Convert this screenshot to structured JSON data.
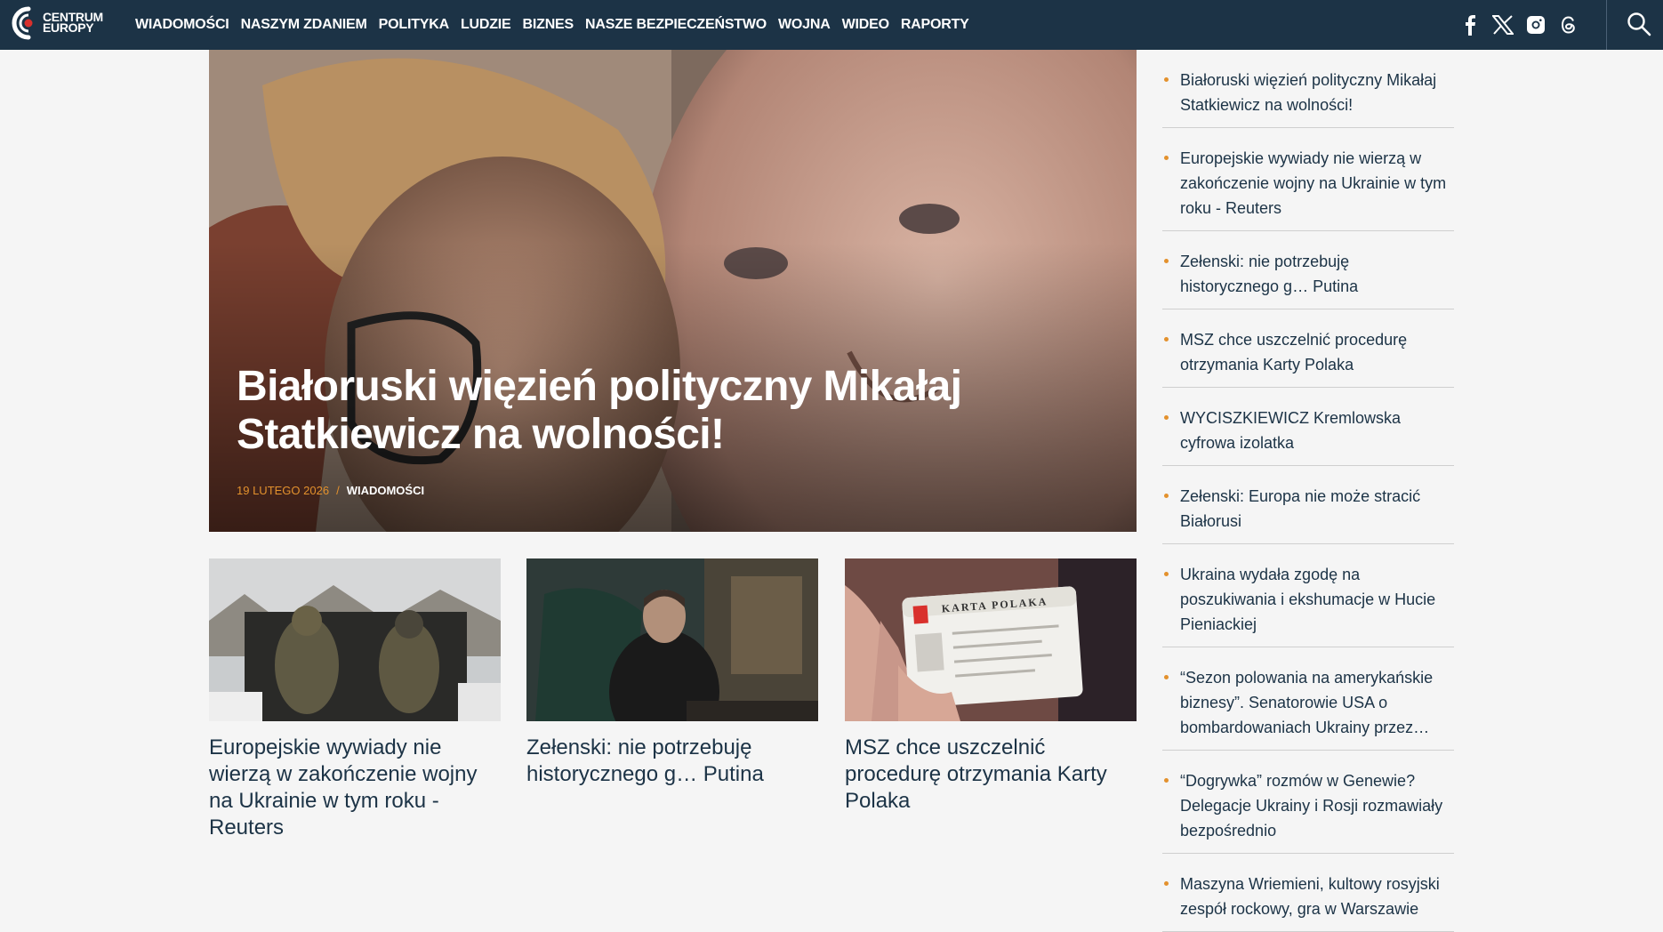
{
  "brand": {
    "name_line1": "CENTRUM",
    "name_line2": "EUROPY",
    "accent_color": "#e3912d",
    "nav_bg": "#1c3346"
  },
  "nav": {
    "items": [
      "WIADOMOŚCI",
      "NASZYM ZDANIEM",
      "POLITYKA",
      "LUDZIE",
      "BIZNES",
      "NASZE BEZPIECZEŃSTWO",
      "WOJNA",
      "WIDEO",
      "RAPORTY"
    ]
  },
  "social": {
    "icons": [
      "facebook-icon",
      "x-icon",
      "instagram-icon",
      "threads-icon"
    ],
    "search_icon": "search-icon"
  },
  "hero": {
    "title": "Białoruski więzień polityczny Mikałaj Statkiewicz na wolności!",
    "date": "19 LUTEGO 2026",
    "separator": "/",
    "category": "WIADOMOŚCI"
  },
  "cards": [
    {
      "title": "Europejskie wywiady nie wierzą w zakończenie wojny na Ukrainie w tym roku - Reuters"
    },
    {
      "title": "Zełenski: nie potrzebuję historycznego g… Putina"
    },
    {
      "title": "MSZ chce uszczelnić procedurę otrzymania Karty Polaka",
      "image_text": "KARTA POLAKA"
    }
  ],
  "sidebar": {
    "items": [
      "Białoruski więzień polityczny Mikałaj Statkiewicz na wolności!",
      "Europejskie wywiady nie wierzą w zakończenie wojny na Ukrainie w tym roku - Reuters",
      "Zełenski: nie potrzebuję historycznego g… Putina",
      "MSZ chce uszczelnić procedurę otrzymania Karty Polaka",
      "WYCISZKIEWICZ Kremlowska cyfrowa izolatka",
      "Zełenski: Europa nie może stracić Białorusi",
      "Ukraina wydała zgodę na poszukiwania i ekshumacje w Hucie Pieniackiej",
      "“Sezon polowania na amerykańskie biznesy”. Senatorowie USA o bombardowaniach Ukrainy przez…",
      "“Dogrywka” rozmów w Genewie? Delegacje Ukrainy i Rosji rozmawiały bezpośrednio",
      "Maszyna Wriemieni, kultowy rosyjski zespół rockowy, gra w Warszawie"
    ]
  }
}
